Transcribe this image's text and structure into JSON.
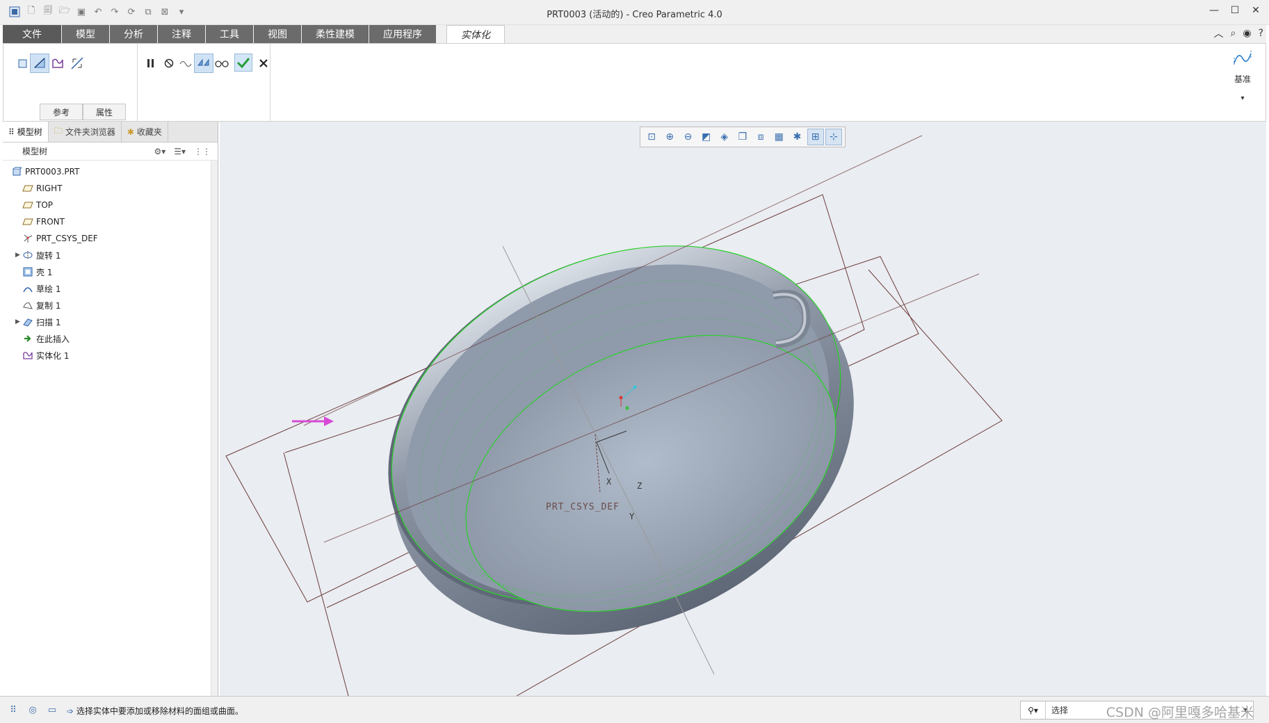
{
  "window": {
    "title": "PRT0003 (活动的) - Creo Parametric 4.0",
    "controls": [
      "—",
      "☐",
      "✕"
    ]
  },
  "quick_access": [
    "window-icon",
    "new-icon",
    "open-icon",
    "open-folder-icon",
    "save-icon",
    "undo-icon",
    "redo-icon",
    "regenerate-icon",
    "windows-icon",
    "close-window-icon",
    "customize-icon"
  ],
  "ribbon": {
    "tabs": [
      "文件",
      "模型",
      "分析",
      "注释",
      "工具",
      "视图",
      "柔性建模",
      "应用程序"
    ],
    "active_tab": "实体化",
    "subtabs": {
      "references": "参考",
      "properties": "属性"
    },
    "datum_label": "基准",
    "dropdown_glyph": "▾"
  },
  "navigator": {
    "tabs": {
      "model_tree": "模型树",
      "folder_browser": "文件夹浏览器",
      "favorites": "收藏夹"
    },
    "tree_title": "模型树",
    "items": [
      {
        "label": "PRT0003.PRT",
        "icon": "part-icon"
      },
      {
        "label": "RIGHT",
        "icon": "datum-plane-icon"
      },
      {
        "label": "TOP",
        "icon": "datum-plane-icon"
      },
      {
        "label": "FRONT",
        "icon": "datum-plane-icon"
      },
      {
        "label": "PRT_CSYS_DEF",
        "icon": "csys-icon"
      },
      {
        "label": "旋转 1",
        "icon": "revolve-icon",
        "expandable": true
      },
      {
        "label": "壳 1",
        "icon": "shell-icon"
      },
      {
        "label": "草绘 1",
        "icon": "sketch-icon"
      },
      {
        "label": "复制 1",
        "icon": "copy-icon"
      },
      {
        "label": "扫描 1",
        "icon": "sweep-icon",
        "expandable": true
      },
      {
        "label": "在此插入",
        "icon": "insert-arrow-icon"
      },
      {
        "label": "实体化 1",
        "icon": "solidify-icon"
      }
    ]
  },
  "graphics": {
    "csys_label": "PRT_CSYS_DEF",
    "axes": {
      "x": "X",
      "y": "Y",
      "z": "Z"
    }
  },
  "status": {
    "message": "选择实体中要添加或移除材料的面组或曲面。",
    "filter_value": "选择",
    "watermark": "CSDN @阿里嘎多哈基米"
  },
  "colors": {
    "tab_bg": "#6b6b6b",
    "viewport_bg": "#eaedf1",
    "model_edge": "#2bd12b",
    "datum_plane": "#6b3b3b",
    "confirm": "#2a9d3a"
  }
}
